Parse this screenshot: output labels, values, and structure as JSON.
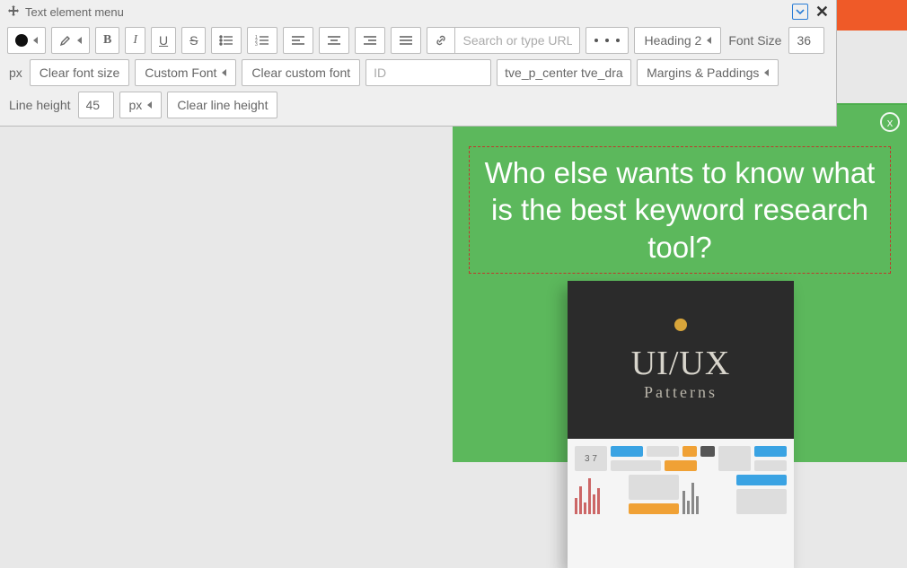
{
  "header": {
    "title": "Text element menu"
  },
  "toolbar": {
    "url_placeholder": "Search or type URL",
    "heading_label": "Heading 2",
    "font_size_label": "Font Size",
    "font_size_value": "36",
    "font_size_unit": "px",
    "clear_font_size": "Clear font size",
    "custom_font": "Custom Font",
    "clear_custom_font": "Clear custom font",
    "id_placeholder": "ID",
    "class_value": "tve_p_center tve_dragg",
    "margins_paddings": "Margins & Paddings",
    "line_height_label": "Line height",
    "line_height_value": "45",
    "line_height_unit": "px",
    "clear_line_height": "Clear line height"
  },
  "canvas": {
    "headline": "Who else wants to know what is the best keyword research tool?",
    "close": "x"
  },
  "book": {
    "title": "UI/UX",
    "subtitle": "Patterns",
    "counter": "3 7"
  }
}
